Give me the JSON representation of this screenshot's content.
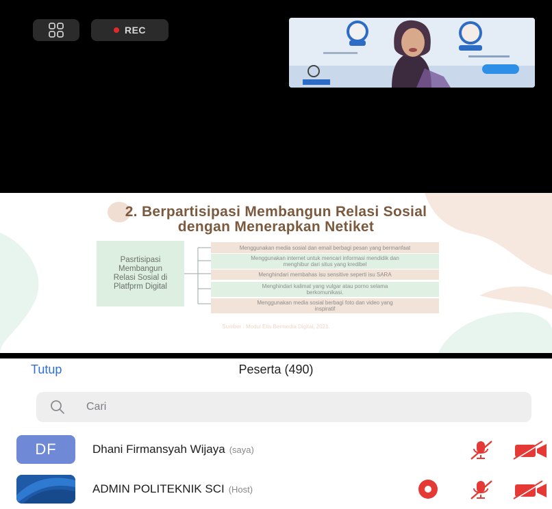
{
  "meeting": {
    "recording_label": "REC",
    "recording_color": "#e02b2b"
  },
  "slide": {
    "number": "2.",
    "title_line1": "Berpartisipasi Membangun Relasi Sosial",
    "title_line2": "dengan Menerapkan Netiket",
    "root_text": "Pasrtisipasi\nMembangun\nRelasi Sosial di\nPlatfprm Digital",
    "branches": [
      "Menggunakan media sosial dan email berbagi pesan yang bermanfaat",
      "Menggunakan internet untuk mencari informasi mendidik dan\nmenghibur dari situs yang kredibel",
      "Menghindari membahas isu sensitive seperti isu SARA",
      "Menghindari kalimat yang vulgar atau porno selama\nberkomunikasi.",
      "Menggunakan media sosial berbagi foto dan video yang\ninspiratif"
    ],
    "source": "Sumber : Modul Etis Bermedia Digital, 2021."
  },
  "participants_panel": {
    "close_label": "Tutup",
    "title": "Peserta (490)",
    "search_placeholder": "Cari",
    "accent_color": "#2f6fd3",
    "muted_icon_color": "#e53935",
    "list": [
      {
        "initials": "DF",
        "name": "Dhani Firmansyah Wijaya",
        "tag": "(saya)",
        "avatar_color": "#6f89d6",
        "mic": "muted",
        "video": "off"
      },
      {
        "initials": "",
        "name": "ADMIN POLITEKNIK SCI",
        "tag": "(Host)",
        "avatar_color": "#1f5aa6",
        "recording": true,
        "mic": "muted",
        "video": "off"
      }
    ]
  }
}
